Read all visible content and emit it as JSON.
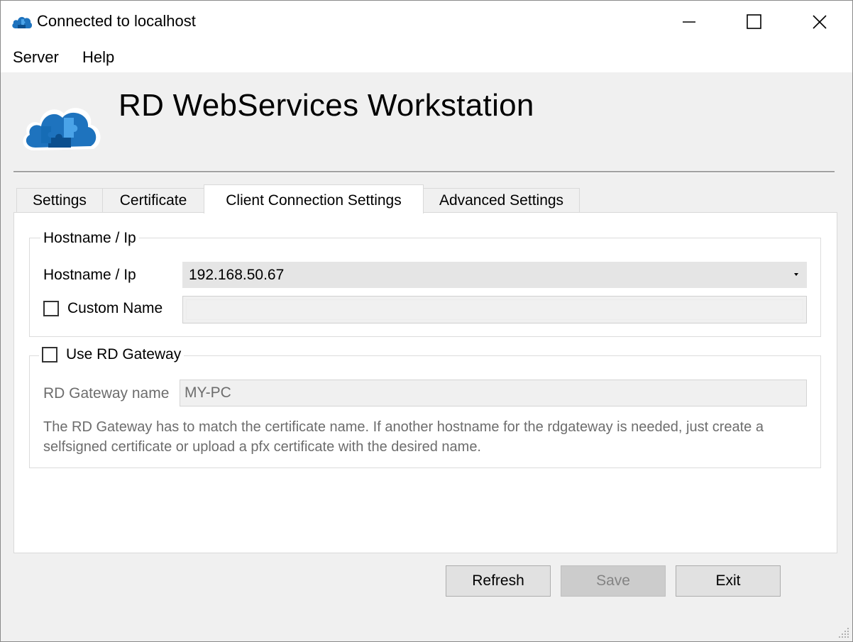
{
  "window": {
    "title": "Connected to localhost",
    "icon": "cloud-puzzle-icon",
    "controls": [
      "minimize-icon",
      "maximize-icon",
      "close-icon"
    ]
  },
  "menu": {
    "items": [
      {
        "label": "Server"
      },
      {
        "label": "Help"
      }
    ]
  },
  "header": {
    "title": "RD WebServices Workstation",
    "logo": "cloud-puzzle-logo"
  },
  "tabs": [
    {
      "label": "Settings",
      "active": false
    },
    {
      "label": "Certificate",
      "active": false
    },
    {
      "label": "Client Connection Settings",
      "active": true
    },
    {
      "label": "Advanced Settings",
      "active": false
    }
  ],
  "hostname_group": {
    "legend": "Hostname / Ip",
    "hostname_label": "Hostname / Ip",
    "hostname_value": "192.168.50.67",
    "custom_name_label": "Custom Name",
    "custom_name_checked": false,
    "custom_name_value": ""
  },
  "gateway_group": {
    "use_gateway_label": "Use RD Gateway",
    "use_gateway_checked": false,
    "gateway_name_label": "RD Gateway name",
    "gateway_name_value": "MY-PC",
    "note": "The RD Gateway has to match the certificate name. If another hostname for the rdgateway is needed, just create a selfsigned certificate or upload a pfx certificate with the desired name."
  },
  "buttons": {
    "refresh": "Refresh",
    "save": "Save",
    "exit": "Exit"
  },
  "colors": {
    "accent_blue": "#1e73be",
    "disabled_text": "#6d6d6d"
  }
}
